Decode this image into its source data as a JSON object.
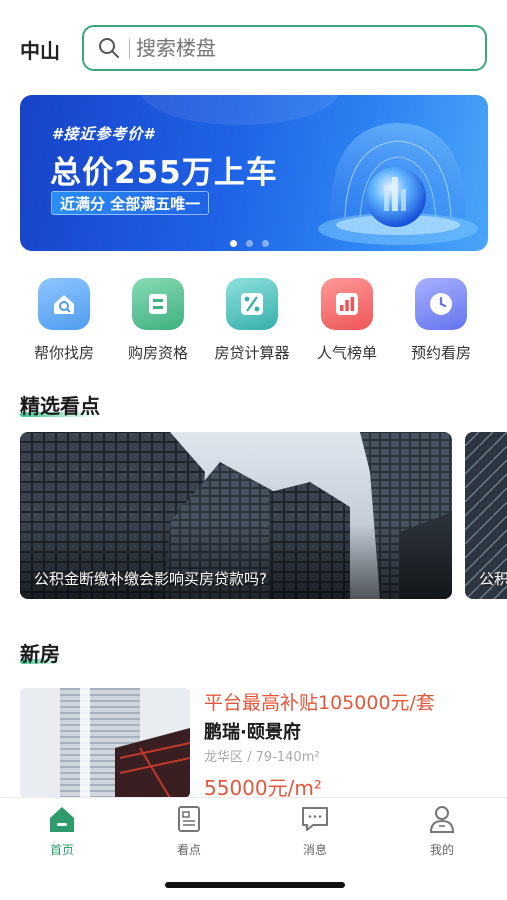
{
  "header": {
    "city": "中山",
    "search_placeholder": "搜索楼盘"
  },
  "banner": {
    "tag": "#接近参考价#",
    "headline": "总价255万上车",
    "subline": "近满分 全部满五唯一",
    "active_dot": 1,
    "dot_count": 3
  },
  "quick_actions": [
    {
      "label": "帮你找房",
      "icon": "house-search-icon",
      "color": "#4f9cf0"
    },
    {
      "label": "购房资格",
      "icon": "qualification-icon",
      "color": "#46b889"
    },
    {
      "label": "房贷计算器",
      "icon": "percent-icon",
      "color": "#3fb6b2"
    },
    {
      "label": "人气榜单",
      "icon": "bar-chart-icon",
      "color": "#f06161"
    },
    {
      "label": "预约看房",
      "icon": "clock-icon",
      "color": "#6f7bf0"
    }
  ],
  "featured": {
    "title": "精选看点",
    "cards": [
      {
        "caption": "公积金断缴补缴会影响买房贷款吗?"
      },
      {
        "caption": "公积"
      }
    ]
  },
  "new_homes": {
    "title": "新房",
    "listing": {
      "promo": "平台最高补贴105000元/套",
      "name": "鹏瑞·颐景府",
      "meta": "龙华区 / 79-140m²",
      "price": "55000元/m²"
    }
  },
  "tabbar": [
    {
      "label": "首页",
      "icon": "home-icon",
      "active": true
    },
    {
      "label": "看点",
      "icon": "article-icon",
      "active": false
    },
    {
      "label": "消息",
      "icon": "message-icon",
      "active": false
    },
    {
      "label": "我的",
      "icon": "profile-icon",
      "active": false
    }
  ],
  "colors": {
    "accent": "#2f9a6c",
    "price": "#e4573b",
    "banner": "#1f63e6"
  }
}
